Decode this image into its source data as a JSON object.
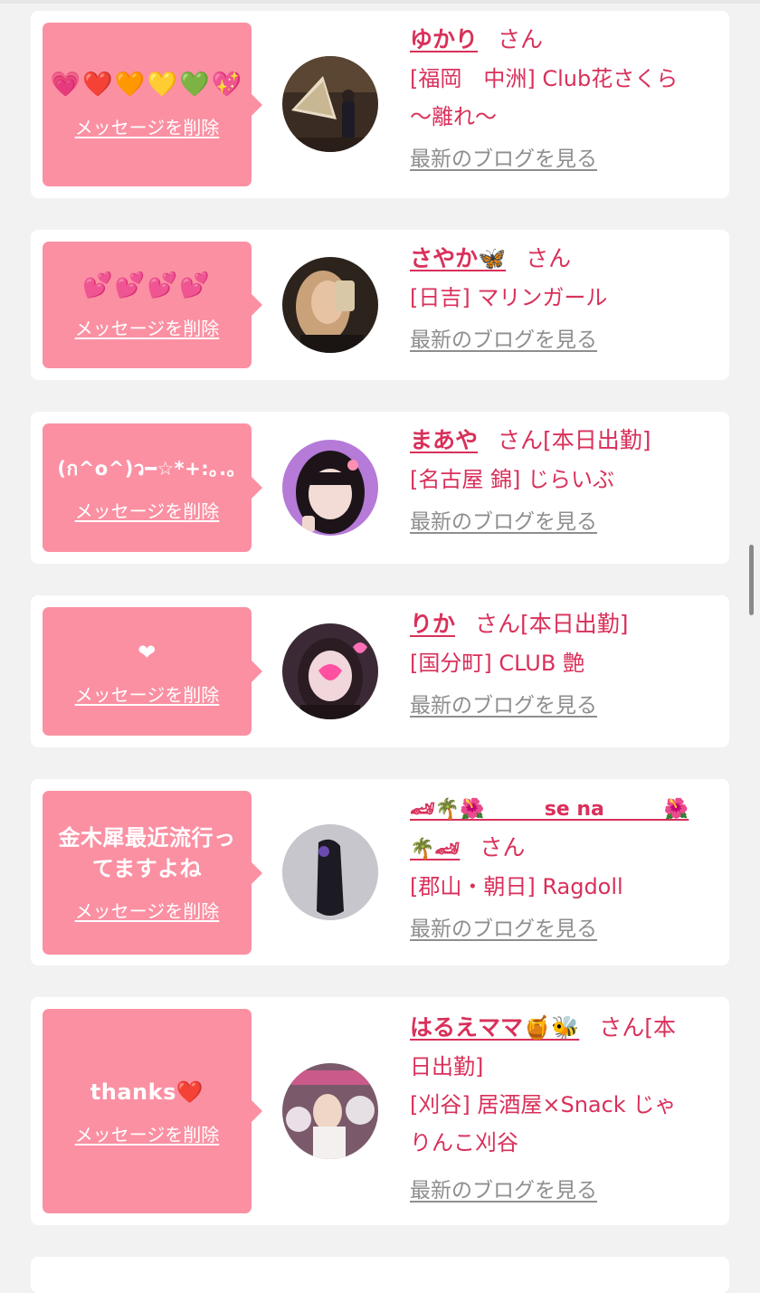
{
  "common": {
    "delete_label": "メッセージを削除",
    "blog_label": "最新のブログを見る",
    "honorific": "さん"
  },
  "cards": [
    {
      "message": "💗❤️🧡💛💚💖",
      "name": "ゆかり",
      "status": "",
      "shop_line1": "[福岡　中洲] Club花さくら",
      "shop_line2": "〜離れ〜"
    },
    {
      "message": "💕💕💕💕",
      "name": "さやか🦋",
      "status": "",
      "shop_line1": "[日吉] マリンガール",
      "shop_line2": ""
    },
    {
      "message": "(ก^o^)ว━☆*+:｡.｡",
      "name": "まあや",
      "status": "[本日出勤]",
      "shop_line1": "[名古屋 錦] じらいぶ",
      "shop_line2": ""
    },
    {
      "message": "❤",
      "name": "りか",
      "status": "[本日出勤]",
      "shop_line1": "[国分町] CLUB 艶",
      "shop_line2": ""
    },
    {
      "message": "金木犀最近流行ってますよね",
      "name_part1": "🏎🌴🌺　　　se na　　　🌺",
      "name_part2": "🌴🏎",
      "status": "",
      "shop_line1": "[郡山・朝日] Ragdoll",
      "shop_line2": ""
    },
    {
      "message": "thanks❤️",
      "name": "はるえママ🍯🐝",
      "status_part1": "[本",
      "status_part2": "日出勤]",
      "shop_line1": "[刈谷] 居酒屋×Snack じゃ",
      "shop_line2": "りんこ刈谷"
    }
  ],
  "colors": {
    "accent": "#d9305a",
    "bubble": "#fb90a3",
    "background": "#f2f2f2",
    "link_gray": "#8e8e8e"
  }
}
